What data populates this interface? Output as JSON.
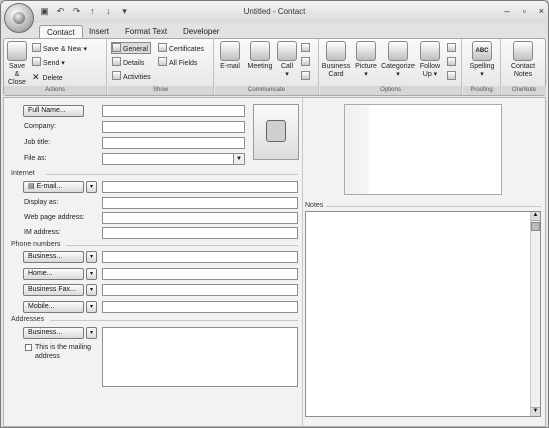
{
  "window": {
    "title": "Untitled - Contact",
    "controls": [
      "–",
      "▫",
      "×"
    ]
  },
  "qat": {
    "icons": [
      "save-icon",
      "undo-icon",
      "redo-icon",
      "up-icon",
      "down-icon",
      "customize-icon"
    ]
  },
  "tabs": [
    "Contact",
    "Insert",
    "Format Text",
    "Developer"
  ],
  "ribbon": {
    "actions": {
      "label": "Actions",
      "save_close": "Save & Close",
      "save_new": "Save & New",
      "send": "Send",
      "delete": "Delete"
    },
    "show": {
      "label": "Show",
      "general": "General",
      "details": "Details",
      "activities": "Activities",
      "certificates": "Certificates",
      "all_fields": "All Fields"
    },
    "communicate": {
      "label": "Communicate",
      "email": "E-mail",
      "meeting": "Meeting",
      "call": "Call"
    },
    "options": {
      "label": "Options",
      "business_card": "Business Card",
      "picture": "Picture",
      "categorize": "Categorize",
      "follow_up": "Follow Up"
    },
    "proofing": {
      "label": "Proofing",
      "spelling": "Spelling",
      "abc": "ABC"
    },
    "onenote": {
      "label": "OneNote",
      "contact_notes": "Contact Notes"
    }
  },
  "form": {
    "full_name": "Full Name...",
    "company": "Company:",
    "job_title": "Job title:",
    "file_as": "File as:",
    "internet": "Internet",
    "email_btn": "E-mail...",
    "display_as": "Display as:",
    "web_page": "Web page address:",
    "im_address": "IM address:",
    "phone_numbers": "Phone numbers",
    "business": "Business...",
    "home": "Home...",
    "business_fax": "Business Fax...",
    "mobile": "Mobile...",
    "addresses": "Addresses",
    "address_business": "Business...",
    "mailing_label": "This is the mailing address",
    "notes": "Notes"
  }
}
